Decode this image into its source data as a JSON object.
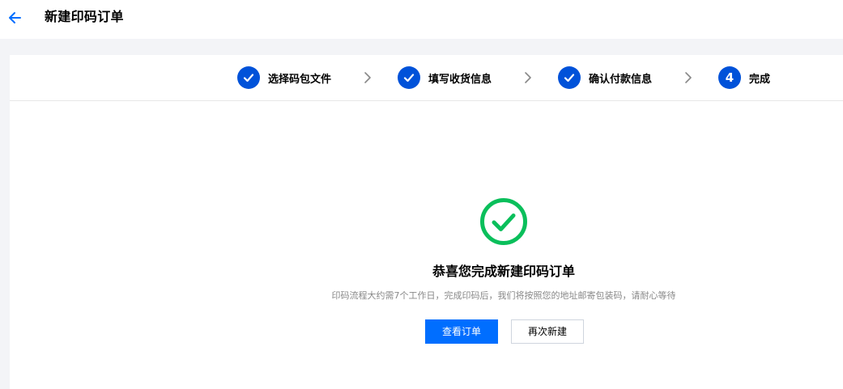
{
  "header": {
    "title": "新建印码订单"
  },
  "steps": [
    {
      "label": "选择码包文件",
      "status": "done"
    },
    {
      "label": "填写收货信息",
      "status": "done"
    },
    {
      "label": "确认付款信息",
      "status": "done"
    },
    {
      "label": "完成",
      "status": "current",
      "number": "4"
    }
  ],
  "result": {
    "title": "恭喜您完成新建印码订单",
    "description": "印码流程大约需7个工作日，完成印码后，我们将按照您的地址邮寄包装码，请耐心等待",
    "primary_button": "查看订单",
    "secondary_button": "再次新建"
  },
  "colors": {
    "accent": "#006eff",
    "step_blue": "#0052d9",
    "success_green": "#0abf5b"
  },
  "icons": {
    "back": "arrow-left-icon",
    "step_done": "check-icon",
    "separator": "chevron-right-icon",
    "success": "check-circle-icon"
  }
}
